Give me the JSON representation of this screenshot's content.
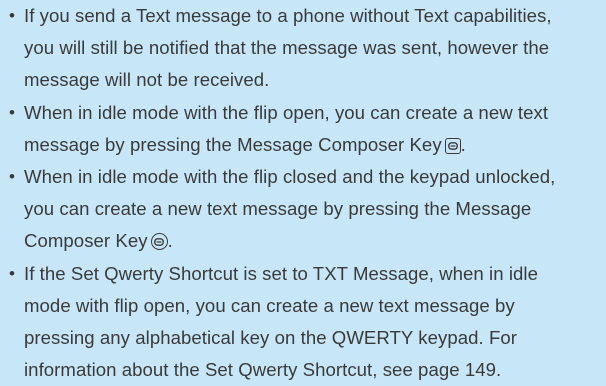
{
  "notes": [
    {
      "bullet": "•",
      "lines": [
        "If you send a Text message to a phone without Text capabilities,",
        "you will still be notified that the message was sent, however the",
        "message will not be received."
      ]
    },
    {
      "bullet": "•",
      "lines": [
        "When in idle mode with the flip open, you can create a new text",
        "message by pressing the Message Composer Key",
        "."
      ],
      "icon": "message-composer-key-square-icon"
    },
    {
      "bullet": "•",
      "lines": [
        "When in idle mode with the flip closed and the keypad unlocked,",
        "you can create a new text message by pressing the Message",
        "Composer Key",
        "."
      ],
      "icon": "message-composer-key-round-icon"
    },
    {
      "bullet": "•",
      "lines": [
        "If the Set Qwerty Shortcut is set to TXT Message, when in idle",
        "mode with flip open, you can create a new text message by",
        "pressing any alphabetical key on the QWERTY keypad. For",
        "information about the Set Qwerty Shortcut, see page 149."
      ]
    }
  ],
  "colors": {
    "background": "#c7e7f9",
    "text": "#3a3a3a"
  }
}
